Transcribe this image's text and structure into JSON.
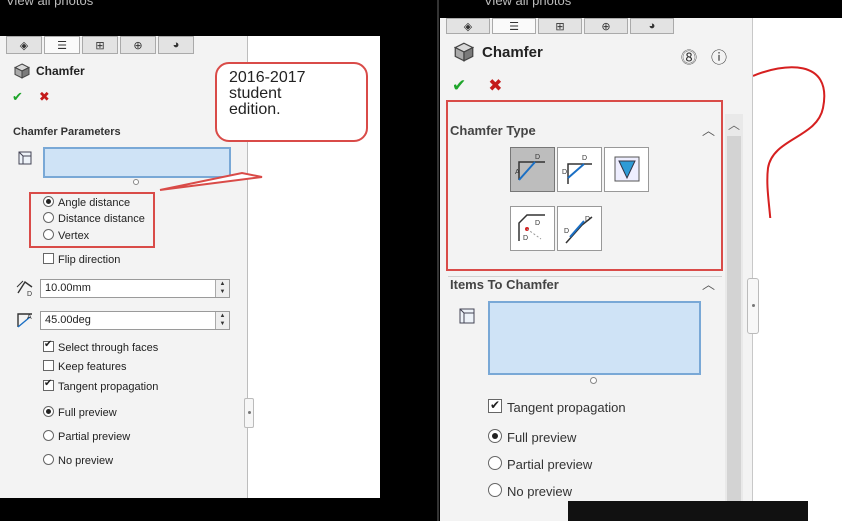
{
  "top_caption": "View all photos",
  "left": {
    "feature_title": "Chamfer",
    "section_title": "Chamfer Parameters",
    "options": [
      {
        "label": "Angle distance",
        "selected": true
      },
      {
        "label": "Distance distance",
        "selected": false
      },
      {
        "label": "Vertex",
        "selected": false
      }
    ],
    "flip_direction": {
      "label": "Flip direction",
      "checked": false
    },
    "distance_value": "10.00mm",
    "angle_value": "45.00deg",
    "checks": [
      {
        "label": "Select through faces",
        "checked": true
      },
      {
        "label": "Keep features",
        "checked": false
      },
      {
        "label": "Tangent propagation",
        "checked": true
      }
    ],
    "previews": [
      {
        "label": "Full preview",
        "selected": true
      },
      {
        "label": "Partial preview",
        "selected": false
      },
      {
        "label": "No preview",
        "selected": false
      }
    ]
  },
  "callout": {
    "line1": "2016-2017",
    "line2": "student",
    "line3": "edition."
  },
  "right": {
    "feature_title": "Chamfer",
    "chamfer_type_title": "Chamfer Type",
    "items_title": "Items To Chamfer",
    "tangent": {
      "label": "Tangent propagation",
      "checked": true
    },
    "previews": [
      {
        "label": "Full preview",
        "selected": true
      },
      {
        "label": "Partial preview",
        "selected": false
      },
      {
        "label": "No preview",
        "selected": false
      }
    ]
  },
  "colors": {
    "accent_red": "#d94b48",
    "ok_green": "#1ea52a",
    "cancel_red": "#c41a1a",
    "selection_blue": "#cfe3f6"
  },
  "icons": [
    "cube-icon",
    "check-icon",
    "close-icon",
    "help-icon",
    "whats-new-icon",
    "collapse-icon",
    "distance-icon",
    "angle-icon",
    "selection-icon"
  ]
}
